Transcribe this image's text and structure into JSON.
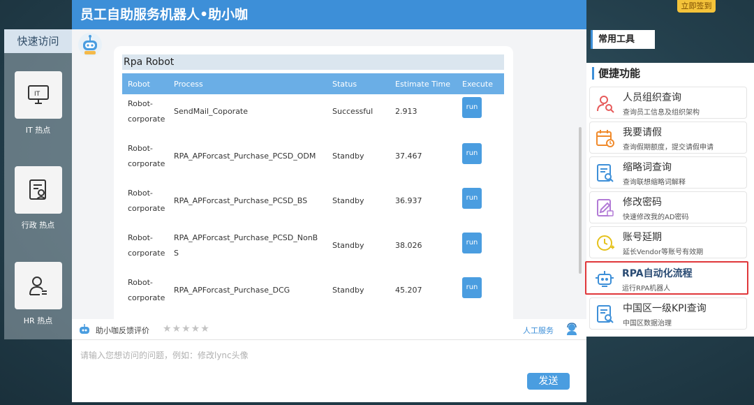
{
  "signin": "立即签到",
  "quick": {
    "title": "快速访问",
    "items": [
      {
        "label": "IT 热点",
        "icon": "it-monitor-icon"
      },
      {
        "label": "行政 热点",
        "icon": "admin-document-icon"
      },
      {
        "label": "HR 热点",
        "icon": "hr-person-icon"
      }
    ]
  },
  "chat": {
    "title": "员工自助服务机器人•助小咖",
    "rpa_title": "Rpa Robot",
    "columns": [
      "Robot",
      "Process",
      "Status",
      "Estimate Time",
      "Execute"
    ],
    "rows": [
      {
        "robot": [
          "Robot-",
          "corporate"
        ],
        "process": [
          "SendMail_Coporate"
        ],
        "status": "Successful",
        "time": "2.913",
        "action": "run"
      },
      {
        "robot": [
          "Robot-",
          "corporate"
        ],
        "process": [
          "RPA_APForcast_Purchase_PCSD_ODM"
        ],
        "status": "Standby",
        "time": "37.467",
        "action": "run"
      },
      {
        "robot": [
          "Robot-",
          "corporate"
        ],
        "process": [
          "RPA_APForcast_Purchase_PCSD_BS"
        ],
        "status": "Standby",
        "time": "36.937",
        "action": "run"
      },
      {
        "robot": [
          "Robot-",
          "corporate"
        ],
        "process": [
          "RPA_APForcast_Purchase_PCSD_NonB",
          "S"
        ],
        "status": "Standby",
        "time": "38.026",
        "action": "run"
      },
      {
        "robot": [
          "Robot-",
          "corporate"
        ],
        "process": [
          "RPA_APForcast_Purchase_DCG"
        ],
        "status": "Standby",
        "time": "45.207",
        "action": "run"
      }
    ],
    "feedback_label": "助小咖反馈评价",
    "stars": "★★★★★",
    "human_service": "人工服务",
    "input_placeholder": "请输入您想访问的问题，例如：修改lync头像",
    "send": "发送"
  },
  "tools": {
    "title": "常用工具"
  },
  "functions": {
    "title": "便捷功能",
    "items": [
      {
        "name": "人员组织查询",
        "desc": "查询员工信息及组织架构",
        "icon": "person-search-icon",
        "color": "#e65a5a"
      },
      {
        "name": "我要请假",
        "desc": "查询假期额度，提交请假申请",
        "icon": "calendar-clock-icon",
        "color": "#f08a2b"
      },
      {
        "name": "缩略词查询",
        "desc": "查询联想缩略词解释",
        "icon": "document-search-icon",
        "color": "#3d8fd8"
      },
      {
        "name": "修改密码",
        "desc": "快速修改我的AD密码",
        "icon": "edit-lock-icon",
        "color": "#b27ad6"
      },
      {
        "name": "账号延期",
        "desc": "延长Vendor等账号有效期",
        "icon": "clock-extend-icon",
        "color": "#e5c21c"
      },
      {
        "name": "RPA自动化流程",
        "desc": "运行RPA机器人",
        "icon": "robot-icon",
        "color": "#3d8fd8"
      },
      {
        "name": "中国区一级KPI查询",
        "desc": "中国区数据治理",
        "icon": "kpi-document-icon",
        "color": "#3d8fd8"
      }
    ]
  },
  "colors": {
    "accent": "#3d8fd8",
    "table_head": "#6aaee6",
    "highlight": "#e0373a"
  }
}
